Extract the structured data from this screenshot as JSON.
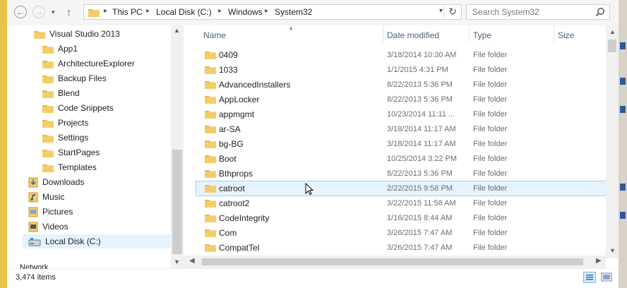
{
  "address_bar": {
    "back_label": "←",
    "forward_label": "→",
    "recent_label": "▾",
    "up_label": "↑",
    "breadcrumbs": [
      "This PC",
      "Local Disk (C:)",
      "Windows",
      "System32"
    ],
    "separator": "▸",
    "dropdown_label": "▾",
    "refresh_label": "↻"
  },
  "search": {
    "placeholder": "Search System32",
    "icon": "search-icon"
  },
  "nav_pane": {
    "items": [
      {
        "label": "Visual Studio 2013",
        "icon": "folder-icon",
        "level": 1
      },
      {
        "label": "App1",
        "icon": "folder-icon",
        "level": 2
      },
      {
        "label": "ArchitectureExplorer",
        "icon": "folder-icon",
        "level": 2
      },
      {
        "label": "Backup Files",
        "icon": "folder-icon",
        "level": 2
      },
      {
        "label": "Blend",
        "icon": "folder-icon",
        "level": 2
      },
      {
        "label": "Code Snippets",
        "icon": "folder-icon",
        "level": 2
      },
      {
        "label": "Projects",
        "icon": "folder-icon",
        "level": 2
      },
      {
        "label": "Settings",
        "icon": "folder-icon",
        "level": 2
      },
      {
        "label": "StartPages",
        "icon": "folder-icon",
        "level": 2
      },
      {
        "label": "Templates",
        "icon": "folder-icon",
        "level": 2
      },
      {
        "label": "Downloads",
        "icon": "downloads-icon",
        "level": 0
      },
      {
        "label": "Music",
        "icon": "music-icon",
        "level": 0
      },
      {
        "label": "Pictures",
        "icon": "pictures-icon",
        "level": 0
      },
      {
        "label": "Videos",
        "icon": "videos-icon",
        "level": 0
      },
      {
        "label": "Local Disk (C:)",
        "icon": "drive-icon",
        "level": 0,
        "selected": true
      }
    ],
    "partial_item": "Network"
  },
  "columns": {
    "name": "Name",
    "date_modified": "Date modified",
    "type": "Type",
    "size": "Size"
  },
  "files": [
    {
      "name": "0409",
      "date": "3/18/2014 10:30 AM",
      "type": "File folder"
    },
    {
      "name": "1033",
      "date": "1/1/2015 4:31 PM",
      "type": "File folder"
    },
    {
      "name": "AdvancedInstallers",
      "date": "8/22/2013 5:36 PM",
      "type": "File folder"
    },
    {
      "name": "AppLocker",
      "date": "8/22/2013 5:36 PM",
      "type": "File folder"
    },
    {
      "name": "appmgmt",
      "date": "10/23/2014 11:11 ...",
      "type": "File folder"
    },
    {
      "name": "ar-SA",
      "date": "3/18/2014 11:17 AM",
      "type": "File folder"
    },
    {
      "name": "bg-BG",
      "date": "3/18/2014 11:17 AM",
      "type": "File folder"
    },
    {
      "name": "Boot",
      "date": "10/25/2014 3:22 PM",
      "type": "File folder"
    },
    {
      "name": "Bthprops",
      "date": "8/22/2013 5:36 PM",
      "type": "File folder"
    },
    {
      "name": "catroot",
      "date": "2/22/2015 9:58 PM",
      "type": "File folder",
      "hover": true
    },
    {
      "name": "catroot2",
      "date": "3/22/2015 11:58 AM",
      "type": "File folder"
    },
    {
      "name": "CodeIntegrity",
      "date": "1/16/2015 8:44 AM",
      "type": "File folder"
    },
    {
      "name": "Com",
      "date": "3/26/2015 7:47 AM",
      "type": "File folder"
    },
    {
      "name": "CompatTel",
      "date": "3/26/2015 7:47 AM",
      "type": "File folder"
    }
  ],
  "status": {
    "item_count": "3,474 items"
  },
  "colors": {
    "folder": "#e8b84a",
    "folder_dark": "#c9962a",
    "hover_bg": "#e5f3ff",
    "hover_border": "#99d1ff",
    "header_text": "#4c607a"
  }
}
